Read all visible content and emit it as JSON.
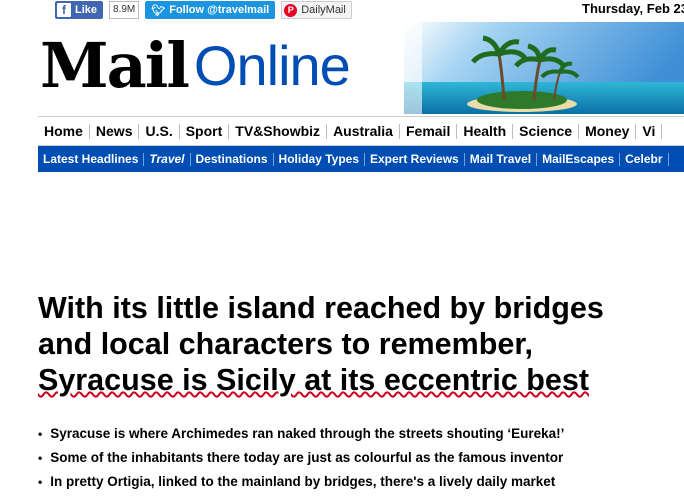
{
  "social": {
    "fb_like": "Like",
    "fb_count": "8.9M",
    "twitter": "Follow @travelmail",
    "pinterest": "DailyMail"
  },
  "date": "Thursday, Feb 23",
  "logo": {
    "mail": "Mail",
    "online": "Online"
  },
  "nav_primary": [
    "Home",
    "News",
    "U.S.",
    "Sport",
    "TV&Showbiz",
    "Australia",
    "Femail",
    "Health",
    "Science",
    "Money",
    "Vi"
  ],
  "nav_travel": [
    "Latest Headlines",
    "Travel",
    "Destinations",
    "Holiday Types",
    "Expert Reviews",
    "Mail Travel",
    "MailEscapes",
    "Celebr"
  ],
  "article": {
    "headline_line1": "With its little island reached by bridges",
    "headline_line2": "and local characters to remember,",
    "headline_line3": "Syracuse is Sicily at its eccentric best",
    "bullets": [
      "Syracuse is where Archimedes ran naked through the streets shouting ‘Eureka!’",
      "Some of the inhabitants there today are just as colourful as the famous inventor",
      "In pretty Ortigia, linked to the mainland by bridges, there's a lively daily market"
    ]
  },
  "colors": {
    "brand_blue": "#004db3",
    "spellcheck_red": "#d0021b"
  }
}
